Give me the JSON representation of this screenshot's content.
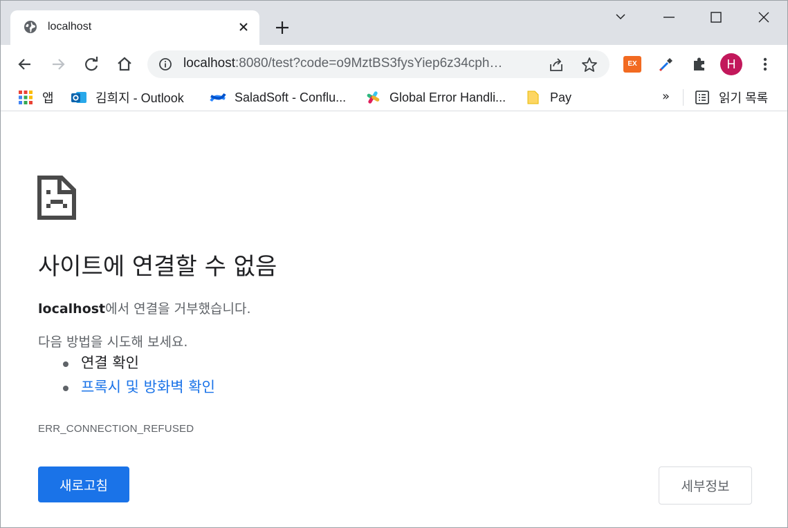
{
  "tab": {
    "title": "localhost",
    "favicon": "globe-icon",
    "close_icon": "close-icon",
    "new_tab_icon": "plus-icon"
  },
  "window_controls": [
    "chevron-down-icon",
    "minimize-icon",
    "maximize-icon",
    "close-icon"
  ],
  "toolbar": {
    "back_icon": "arrow-left-icon",
    "forward_icon": "arrow-right-icon",
    "reload_icon": "reload-icon",
    "home_icon": "home-icon",
    "url_host": "localhost",
    "url_rest": ":8080/test?code=o9MztBS3fysYiep6z34cph…",
    "site_info_icon": "info-icon",
    "share_icon": "share-icon",
    "star_icon": "star-icon",
    "extension_ex_label": "EX",
    "eyedropper_icon": "eyedropper-icon",
    "extensions_icon": "puzzle-icon",
    "profile_initial": "H",
    "menu_icon": "kebab-menu-icon"
  },
  "bookmarks": {
    "items": [
      {
        "label": "앱",
        "icon": "apps-grid-icon"
      },
      {
        "label": "김희지 - Outlook",
        "icon": "outlook-icon"
      },
      {
        "label": "SaladSoft - Conflu...",
        "icon": "confluence-icon"
      },
      {
        "label": "Global Error Handli...",
        "icon": "slack-icon"
      },
      {
        "label": "Pay",
        "icon": "folder-icon"
      }
    ],
    "more": "»",
    "reading_list": "읽기 목록",
    "reading_list_icon": "reading-list-icon"
  },
  "error": {
    "icon": "sad-page-icon",
    "title": "사이트에 연결할 수 없음",
    "host": "localhost",
    "message": "에서 연결을 거부했습니다.",
    "try_label": "다음 방법을 시도해 보세요.",
    "suggestions": [
      "연결 확인",
      "프록시 및 방화벽 확인"
    ],
    "code": "ERR_CONNECTION_REFUSED",
    "reload_button": "새로고침",
    "details_button": "세부정보"
  },
  "colors": {
    "accent": "#1a73e8",
    "tabstrip": "#dee1e6",
    "omnibox": "#f1f3f4",
    "avatar": "#c2185b",
    "extension_ex": "#f26a21"
  }
}
